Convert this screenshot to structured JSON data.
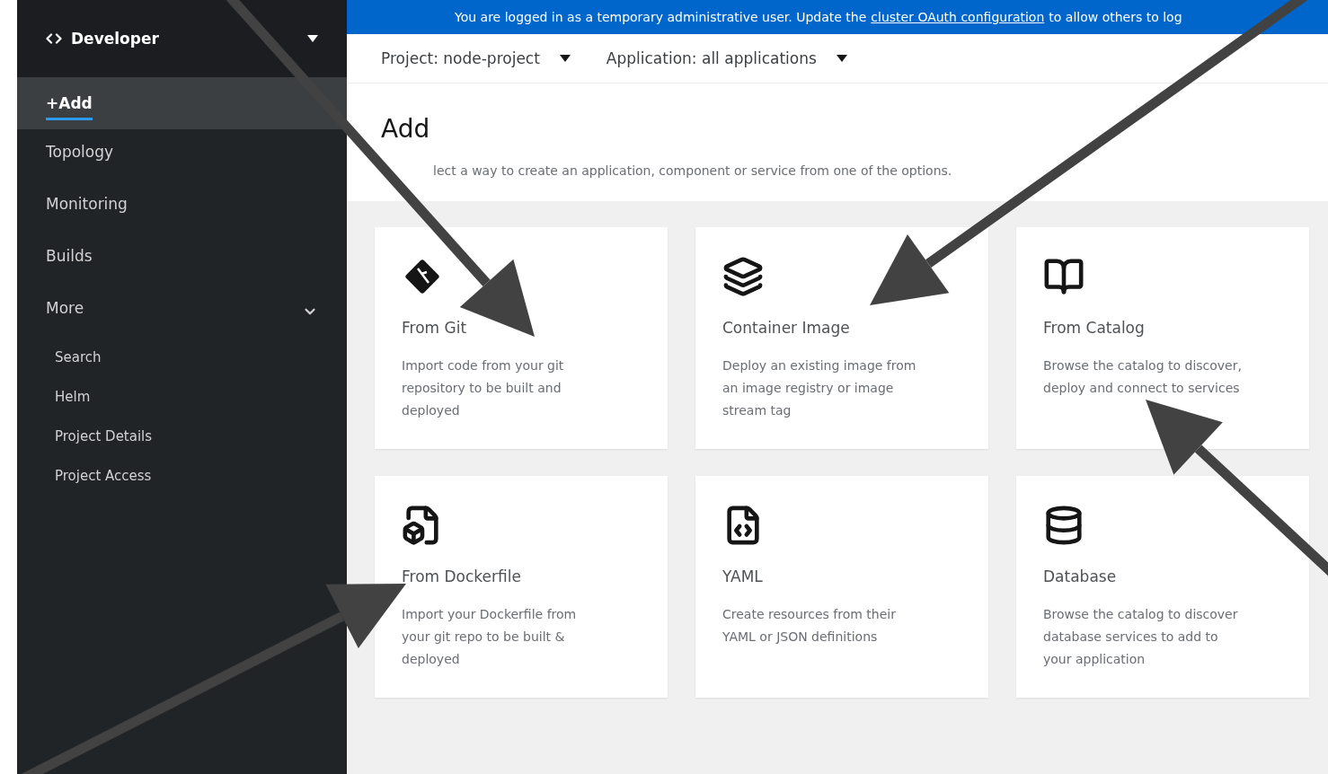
{
  "banner": {
    "text_before": "You are logged in as a temporary administrative user. Update the",
    "link": "cluster OAuth configuration",
    "text_after": "to allow others to log"
  },
  "perspective": {
    "label": "Developer"
  },
  "nav": [
    {
      "label": "+Add",
      "selected": true
    },
    {
      "label": "Topology",
      "selected": false
    },
    {
      "label": "Monitoring",
      "selected": false
    },
    {
      "label": "Builds",
      "selected": false
    },
    {
      "label": "More",
      "selected": false,
      "expanded": true,
      "children": [
        {
          "label": "Search",
          "selected": false
        },
        {
          "label": "Helm",
          "selected": false
        },
        {
          "label": "Project Details",
          "selected": false
        },
        {
          "label": "Project Access",
          "selected": false
        }
      ]
    }
  ],
  "toolbar": [
    {
      "label": "Project: node-project"
    },
    {
      "label": "Application: all applications"
    }
  ],
  "page": {
    "title": "Add",
    "description": "lect a way to create an application, component or service from one of the options."
  },
  "cards": [
    {
      "kind": "git",
      "title": "From Git",
      "description": "Import code from your git repository to be built and deployed"
    },
    {
      "kind": "container",
      "title": "Container Image",
      "description": "Deploy an existing image from an image registry or image stream tag"
    },
    {
      "kind": "catalog",
      "title": "From Catalog",
      "description": "Browse the catalog to discover, deploy and connect to services"
    },
    {
      "kind": "dockerfile",
      "title": "From Dockerfile",
      "description": "Import your Dockerfile from your git repo to be built & deployed"
    },
    {
      "kind": "yaml",
      "title": "YAML",
      "description": "Create resources from their YAML or JSON definitions"
    },
    {
      "kind": "database",
      "title": "Database",
      "description": "Browse the catalog to discover database services to add to your application"
    }
  ]
}
